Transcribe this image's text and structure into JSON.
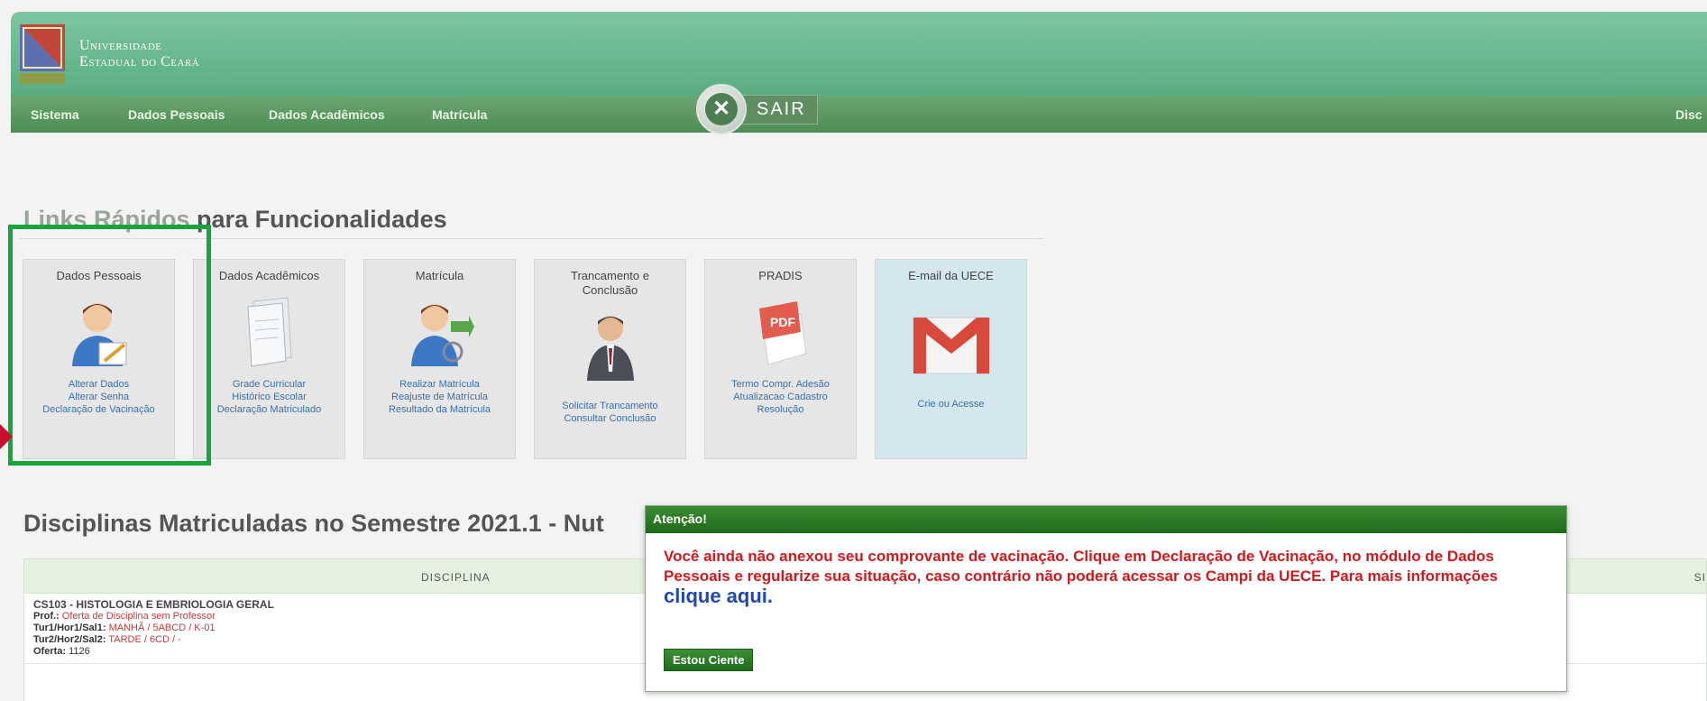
{
  "header": {
    "university_line1": "Universidade",
    "university_line2": "Estadual do Ceará"
  },
  "menu": {
    "items": [
      "Sistema",
      "Dados Pessoais",
      "Dados Acadêmicos",
      "Matrícula"
    ],
    "right_item": "Disc",
    "sair_label": "SAIR"
  },
  "quick_links": {
    "title_faded": "Links Rápidos",
    "title_rest": "para Funcionalidades",
    "cards": [
      {
        "title": "Dados Pessoais",
        "icon": "user-edit-icon",
        "links": [
          "Alterar Dados",
          "Alterar Senha",
          "Declaração de Vacinação"
        ]
      },
      {
        "title": "Dados Acadêmicos",
        "icon": "documents-icon",
        "links": [
          "Grade Curricular",
          "Histórico Escolar",
          "Declaração Matriculado"
        ]
      },
      {
        "title": "Matrícula",
        "icon": "user-arrow-icon",
        "links": [
          "Realizar Matrícula",
          "Reajuste de Matrícula",
          "Resultado da Matrícula"
        ]
      },
      {
        "title": "Trancamento e Conclusão",
        "icon": "businessman-icon",
        "links": [
          "Solicitar Trancamento",
          "Consultar Conclusão"
        ]
      },
      {
        "title": "PRADIS",
        "icon": "pdf-icon",
        "links": [
          "Termo Compr. Adesão",
          "Atualizacao Cadastro",
          "Resolução"
        ]
      },
      {
        "title": "E-mail da UECE",
        "icon": "gmail-icon",
        "links": [
          "Crie ou Acesse"
        ]
      }
    ]
  },
  "disciplines": {
    "title": "Disciplinas Matriculadas no Semestre 2021.1 - Nut",
    "col_disciplina": "DISCIPLINA",
    "col_si": "SI",
    "row1": {
      "name": "CS103 - HISTOLOGIA E EMBRIOLOGIA GERAL",
      "prof_label": "Prof.:",
      "prof_value": "Oferta de Disciplina sem Professor",
      "tur1_label": "Tur1/Hor1/Sal1:",
      "tur1_value": "MANHÃ / 5ABCD / K-01",
      "tur2_label": "Tur2/Hor2/Sal2:",
      "tur2_value": "TARDE / 6CD / -",
      "oferta_label": "Oferta:",
      "oferta_value": "1126"
    }
  },
  "modal": {
    "title": "Atenção!",
    "message": "Você ainda não anexou seu comprovante de vacinação. Clique em Declaração de Vacinação, no módulo de Dados Pessoais e regularize sua situação, caso contrário não poderá acessar os Campi da UECE. Para mais informações",
    "link": "clique aqui.",
    "button": "Estou Ciente"
  }
}
